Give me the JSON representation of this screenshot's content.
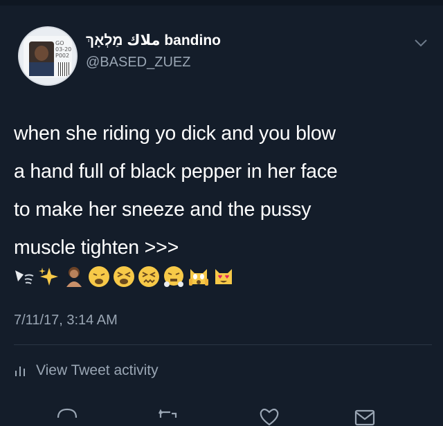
{
  "tweet": {
    "display_name": "ملاك מַלְאָךְ bandino",
    "handle": "@BASED_ZUEZ",
    "text_lines": [
      "when she riding yo dick and you blow",
      "a hand full of black pepper in her face",
      "to make her sneeze and the pussy",
      "muscle tighten >>>"
    ],
    "emojis": [
      "sneeze-wind-icon",
      "sparkles-icon",
      "person-icon",
      "weary-face-icon",
      "tired-face-icon",
      "confounded-face-icon",
      "steam-face-icon",
      "scream-cat-icon",
      "heart-eyes-cat-icon"
    ],
    "timestamp": "7/11/17, 3:14 AM",
    "activity_label": "View Tweet activity",
    "avatar_card_text": "GO\n03-20\nP002"
  },
  "colors": {
    "background": "#141d2a",
    "text": "#ffffff",
    "muted": "#9aa6b4",
    "divider": "#2b3645"
  }
}
